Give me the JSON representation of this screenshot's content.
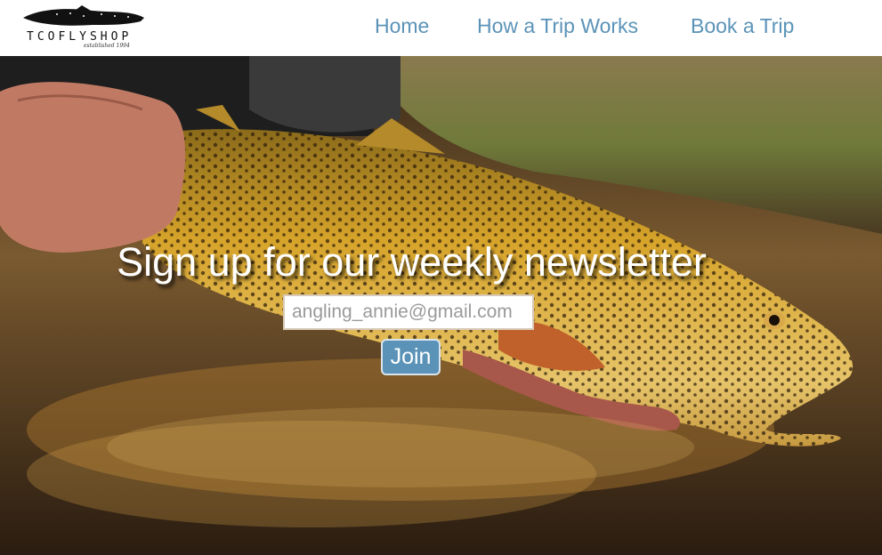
{
  "logo": {
    "name": "TCOFLYSHOP",
    "tagline": "established 1994"
  },
  "nav": [
    {
      "label": "Home"
    },
    {
      "label": "How a Trip Works"
    },
    {
      "label": "Book a Trip"
    }
  ],
  "hero": {
    "headline": "Sign up for our weekly newsletter",
    "email_placeholder": "angling_annie@gmail.com",
    "join_label": "Join"
  },
  "colors": {
    "nav_link": "#5b93b8",
    "button": "#5b93b8"
  }
}
